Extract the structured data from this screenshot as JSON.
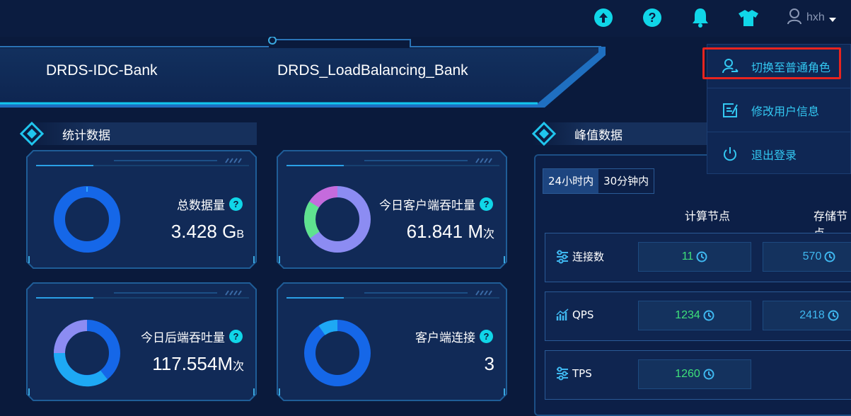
{
  "topbar": {
    "icons": [
      "upload-icon",
      "help-icon",
      "bell-icon",
      "theme-shirt-icon",
      "user-icon"
    ],
    "username": "hxh",
    "accent": "#10d6e8"
  },
  "clusters": {
    "tab1": "DRDS-IDC-Bank",
    "tab2": "DRDS_LoadBalancing_Bank"
  },
  "stats": {
    "title": "统计数据",
    "cards": [
      {
        "label": "总数据量",
        "value": "3.428 ",
        "unit": "G",
        "unit_small": "B"
      },
      {
        "label": "今日客户端吞吐量",
        "value": "61.841 ",
        "unit": "M",
        "unit_small": "次"
      },
      {
        "label": "今日后端吞吐量",
        "value": "117.554",
        "unit": "M",
        "unit_small": "次"
      },
      {
        "label": "客户端连接",
        "value": "3",
        "unit": "",
        "unit_small": ""
      }
    ]
  },
  "peak": {
    "title": "峰值数据",
    "tabs": [
      "24小时内",
      "30分钟内"
    ],
    "active_tab": "24小时内",
    "col_compute": "计算节点",
    "col_storage": "存储节点",
    "rows": [
      {
        "label": "连接数",
        "icon": "sliders-icon",
        "compute": "11",
        "storage": "570"
      },
      {
        "label": "QPS",
        "icon": "bar-chart-icon",
        "compute": "1234",
        "storage": "2418"
      },
      {
        "label": "TPS",
        "icon": "sliders-icon",
        "compute": "1260",
        "storage": ""
      }
    ]
  },
  "user_menu": {
    "items": [
      {
        "label": "切换至普通角色",
        "icon": "switch-role-icon"
      },
      {
        "label": "修改用户信息",
        "icon": "edit-user-icon"
      },
      {
        "label": "退出登录",
        "icon": "power-icon"
      }
    ]
  }
}
